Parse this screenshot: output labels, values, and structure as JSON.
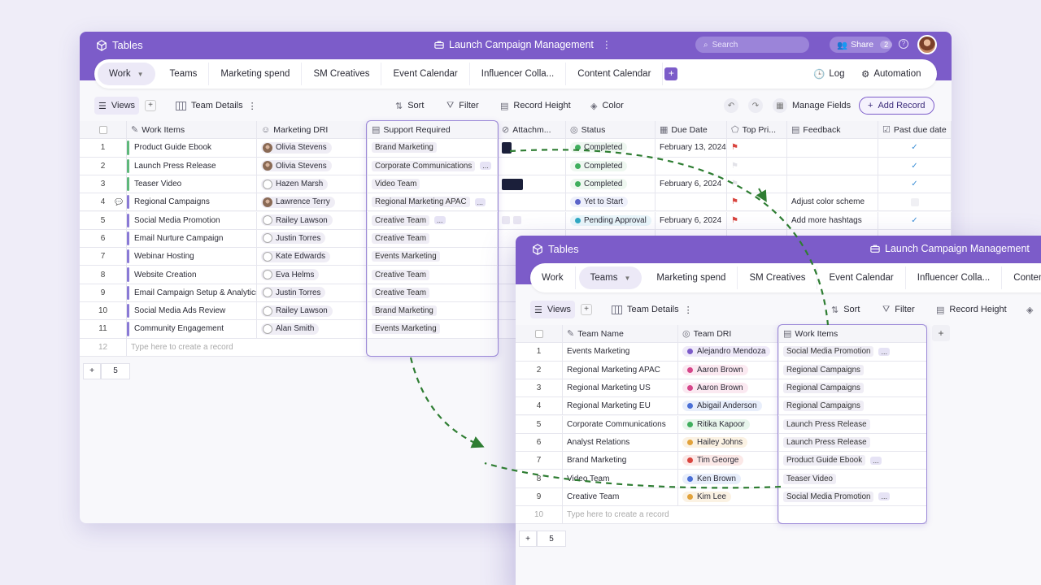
{
  "win1": {
    "app": "Tables",
    "doc_title": "Launch Campaign Management",
    "search_placeholder": "Search",
    "share_label": "Share",
    "share_count": "2",
    "tabs": [
      "Work",
      "Teams",
      "Marketing spend",
      "SM Creatives",
      "Event Calendar",
      "Influencer Colla...",
      "Content Calendar"
    ],
    "log_label": "Log",
    "automation_label": "Automation",
    "toolbar": {
      "views": "Views",
      "view_name": "Team Details",
      "sort": "Sort",
      "filter": "Filter",
      "record_height": "Record Height",
      "color": "Color",
      "manage_fields": "Manage Fields",
      "add_record": "Add Record"
    },
    "columns": [
      "Work Items",
      "Marketing DRI",
      "Support Required",
      "Attachm...",
      "Status",
      "Due Date",
      "Top Pri...",
      "Feedback",
      "Past due date"
    ],
    "rows": [
      {
        "num": "1",
        "item": "Product Guide Ebook",
        "color": "#5fb87a",
        "dri": "Olivia Stevens",
        "photo": true,
        "support": "Brand Marketing",
        "more": "",
        "attach": "thumb-sm",
        "status": "Completed",
        "status_color": "#3fae5d",
        "due": "February 13, 2024",
        "flag": "on",
        "feedback": "",
        "past": "check"
      },
      {
        "num": "2",
        "item": "Launch Press Release",
        "color": "#5fb87a",
        "dri": "Olivia Stevens",
        "photo": true,
        "support": "Corporate Communications",
        "more": "...",
        "attach": "",
        "status": "Completed",
        "status_color": "#3fae5d",
        "due": "",
        "flag": "off",
        "feedback": "",
        "past": "check"
      },
      {
        "num": "3",
        "item": "Teaser Video",
        "color": "#5fb87a",
        "dri": "Hazen Marsh",
        "photo": false,
        "support": "Video Team",
        "more": "",
        "attach": "thumb",
        "status": "Completed",
        "status_color": "#3fae5d",
        "due": "February 6, 2024",
        "flag": "off",
        "feedback": "",
        "past": "check"
      },
      {
        "num": "4",
        "item": "Regional Campaigns",
        "color": "#8a7ad6",
        "dri": "Lawrence Terry",
        "photo": true,
        "support": "Regional Marketing APAC",
        "more": "...",
        "attach": "",
        "status": "Yet to Start",
        "status_color": "#5a63c9",
        "due": "",
        "flag": "on",
        "feedback": "Adjust color scheme",
        "past": "box"
      },
      {
        "num": "5",
        "item": "Social Media Promotion",
        "color": "#8a7ad6",
        "dri": "Railey Lawson",
        "photo": false,
        "support": "Creative Team",
        "more": "...",
        "attach": "mini",
        "status": "Pending Approval",
        "status_color": "#2fa9c4",
        "due": "February 6, 2024",
        "flag": "on",
        "feedback": "Add more hashtags",
        "past": "check"
      },
      {
        "num": "6",
        "item": "Email Nurture Campaign",
        "color": "#8a7ad6",
        "dri": "Justin Torres",
        "photo": false,
        "support": "Creative Team",
        "more": "",
        "attach": "",
        "status": "",
        "status_color": "",
        "due": "",
        "flag": "",
        "feedback": "",
        "past": ""
      },
      {
        "num": "7",
        "item": "Webinar Hosting",
        "color": "#8a7ad6",
        "dri": "Kate Edwards",
        "photo": false,
        "support": "Events Marketing",
        "more": "",
        "attach": "",
        "status": "",
        "status_color": "",
        "due": "",
        "flag": "",
        "feedback": "",
        "past": ""
      },
      {
        "num": "8",
        "item": "Website Creation",
        "color": "#8a7ad6",
        "dri": "Eva Helms",
        "photo": false,
        "support": "Creative Team",
        "more": "",
        "attach": "",
        "status": "",
        "status_color": "",
        "due": "",
        "flag": "",
        "feedback": "",
        "past": ""
      },
      {
        "num": "9",
        "item": "Email Campaign Setup & Analytics",
        "color": "#8a7ad6",
        "dri": "Justin Torres",
        "photo": false,
        "support": "Creative Team",
        "more": "",
        "attach": "",
        "status": "",
        "status_color": "",
        "due": "",
        "flag": "",
        "feedback": "",
        "past": ""
      },
      {
        "num": "10",
        "item": "Social Media Ads Review",
        "color": "#8a7ad6",
        "dri": "Railey Lawson",
        "photo": false,
        "support": "Brand Marketing",
        "more": "",
        "attach": "",
        "status": "",
        "status_color": "",
        "due": "",
        "flag": "",
        "feedback": "",
        "past": ""
      },
      {
        "num": "11",
        "item": "Community Engagement",
        "color": "#8a7ad6",
        "dri": "Alan Smith",
        "photo": false,
        "support": "Events Marketing",
        "more": "",
        "attach": "",
        "status": "",
        "status_color": "",
        "due": "",
        "flag": "",
        "feedback": "",
        "past": ""
      }
    ],
    "new_row_num": "12",
    "new_row_placeholder": "Type here to create a record",
    "footer_count": "5"
  },
  "win2": {
    "app": "Tables",
    "doc_title": "Launch Campaign Management",
    "tabs": [
      "Work",
      "Teams",
      "Marketing spend",
      "SM Creatives",
      "Event Calendar",
      "Influencer Colla...",
      "Content"
    ],
    "toolbar": {
      "views": "Views",
      "view_name": "Team Details",
      "sort": "Sort",
      "filter": "Filter",
      "record_height": "Record Height"
    },
    "columns": [
      "Team Name",
      "Team DRI",
      "Work Items"
    ],
    "rows": [
      {
        "num": "1",
        "team": "Events Marketing",
        "dri": "Alejandro Mendoza",
        "dri_color": "#7c5cc9",
        "dri_bg": "#efeaf9",
        "work": "Social Media Promotion",
        "more": "..."
      },
      {
        "num": "2",
        "team": "Regional Marketing APAC",
        "dri": "Aaron Brown",
        "dri_color": "#d6468a",
        "dri_bg": "#fbe9f1",
        "work": "Regional Campaigns",
        "more": ""
      },
      {
        "num": "3",
        "team": "Regional Marketing US",
        "dri": "Aaron Brown",
        "dri_color": "#d6468a",
        "dri_bg": "#fbe9f1",
        "work": "Regional Campaigns",
        "more": ""
      },
      {
        "num": "4",
        "team": "Regional Marketing EU",
        "dri": "Abigail Anderson",
        "dri_color": "#4a6fd6",
        "dri_bg": "#e8eefb",
        "work": "Regional Campaigns",
        "more": ""
      },
      {
        "num": "5",
        "team": "Corporate Communications",
        "dri": "Ritika Kapoor",
        "dri_color": "#3fae5d",
        "dri_bg": "#e8f6ec",
        "work": "Launch Press Release",
        "more": ""
      },
      {
        "num": "6",
        "team": "Analyst Relations",
        "dri": "Hailey Johns",
        "dri_color": "#e2a23a",
        "dri_bg": "#fbf2e3",
        "work": "Launch Press Release",
        "more": ""
      },
      {
        "num": "7",
        "team": "Brand Marketing",
        "dri": "Tim George",
        "dri_color": "#d9453f",
        "dri_bg": "#fbe8e7",
        "work": "Product Guide Ebook",
        "more": "..."
      },
      {
        "num": "8",
        "team": "Video Team",
        "dri": "Ken Brown",
        "dri_color": "#4a6fd6",
        "dri_bg": "#e8eefb",
        "work": "Teaser Video",
        "more": ""
      },
      {
        "num": "9",
        "team": "Creative Team",
        "dri": "Kim Lee",
        "dri_color": "#e2a23a",
        "dri_bg": "#fbf2e3",
        "work": "Social Media Promotion",
        "more": "..."
      }
    ],
    "new_row_num": "10",
    "new_row_placeholder": "Type here to create a record",
    "footer_count": "5"
  },
  "colors": {
    "brand": "#7c5cc9",
    "arrow": "#2e7d32"
  }
}
